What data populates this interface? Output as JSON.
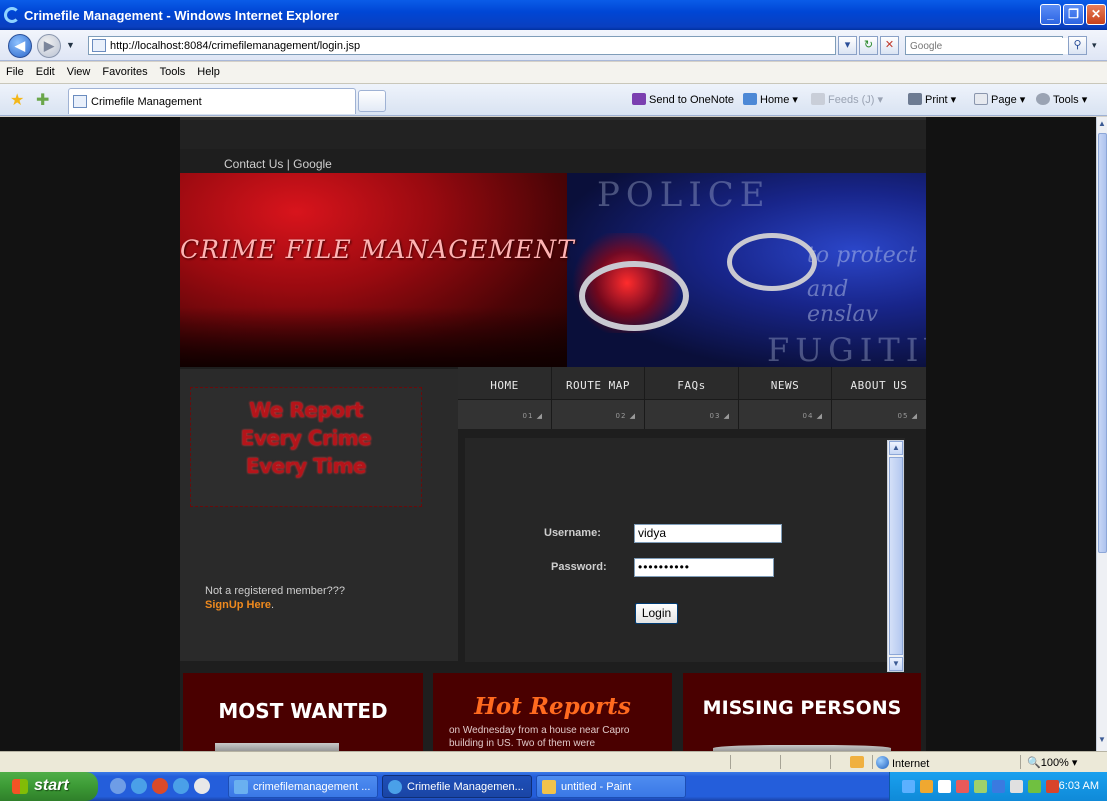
{
  "window": {
    "title": "Crimefile Management - Windows Internet Explorer"
  },
  "address": {
    "url": "http://localhost:8084/crimefilemanagement/login.jsp",
    "search_placeholder": "Google"
  },
  "menubar": [
    "File",
    "Edit",
    "View",
    "Favorites",
    "Tools",
    "Help"
  ],
  "tab": {
    "label": "Crimefile Management"
  },
  "commandbar": {
    "onenote": "Send to OneNote",
    "home": "Home",
    "feeds": "Feeds (J)",
    "print": "Print",
    "page": "Page",
    "tools": "Tools"
  },
  "site": {
    "toplinks": "Contact Us | Google",
    "banner_title": "CRIME FILE MANAGEMENT",
    "banner_words": {
      "police": "POLICE",
      "fugitive": "FUGITIVE",
      "protect": "to protect",
      "enslave": "and enslav"
    },
    "slogan": [
      "We Report",
      "Every Crime",
      "Every Time"
    ],
    "nav": [
      {
        "label": "HOME",
        "num": "01"
      },
      {
        "label": "ROUTE MAP",
        "num": "02"
      },
      {
        "label": "FAQs",
        "num": "03"
      },
      {
        "label": "NEWS",
        "num": "04"
      },
      {
        "label": "ABOUT US",
        "num": "05"
      }
    ],
    "not_registered": "Not a registered member???",
    "signup": "SignUp Here",
    "signup_dot": ".",
    "login": {
      "username_label": "Username:",
      "username_value": "vidya",
      "password_label": "Password:",
      "password_value": "••••••••••",
      "button": "Login"
    },
    "boxes": {
      "most_wanted": "MOST WANTED",
      "hot_reports": "Hot Reports",
      "hot_text": "on Wednesday from a house near Capro building in US. Two of them were",
      "missing": "MISSING PERSONS"
    }
  },
  "statusbar": {
    "zone": "Internet",
    "zoom": "100%"
  },
  "taskbar": {
    "start": "start",
    "tasks": [
      "crimefilemanagement ...",
      "Crimefile Managemen...",
      "untitled - Paint"
    ],
    "clock": "6:03 AM"
  }
}
